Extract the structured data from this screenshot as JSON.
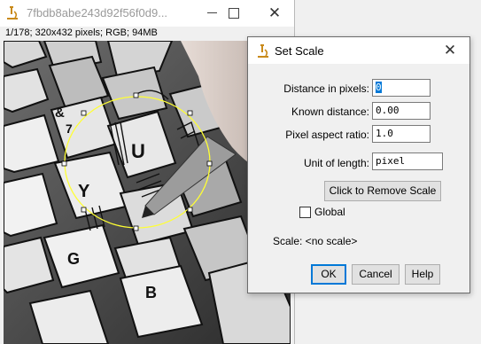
{
  "image_window": {
    "title": "7fbdb8abe243d92f56f0d9...",
    "info": "1/178; 320x432 pixels; RGB; 94MB",
    "controls": {
      "minimize": "minimize",
      "maximize": "maximize",
      "close": "✕"
    },
    "key_letters": {
      "ampersand": "&",
      "seven": "7",
      "u": "U",
      "y": "Y",
      "g": "G",
      "b": "B"
    },
    "selection_color": "#ffff33"
  },
  "dialog": {
    "title": "Set Scale",
    "close_glyph": "✕",
    "fields": {
      "distance_pixels": {
        "label": "Distance in pixels:",
        "value": "0"
      },
      "known_distance": {
        "label": "Known distance:",
        "value": "0.00"
      },
      "aspect_ratio": {
        "label": "Pixel aspect ratio:",
        "value": "1.0"
      },
      "unit": {
        "label": "Unit of length:",
        "value": "pixel"
      }
    },
    "remove_scale_button": "Click to Remove Scale",
    "global_checkbox": {
      "label": "Global",
      "checked": false
    },
    "scale_text": "Scale: <no scale>",
    "buttons": {
      "ok": "OK",
      "cancel": "Cancel",
      "help": "Help"
    },
    "accent_color": "#0078d7"
  }
}
